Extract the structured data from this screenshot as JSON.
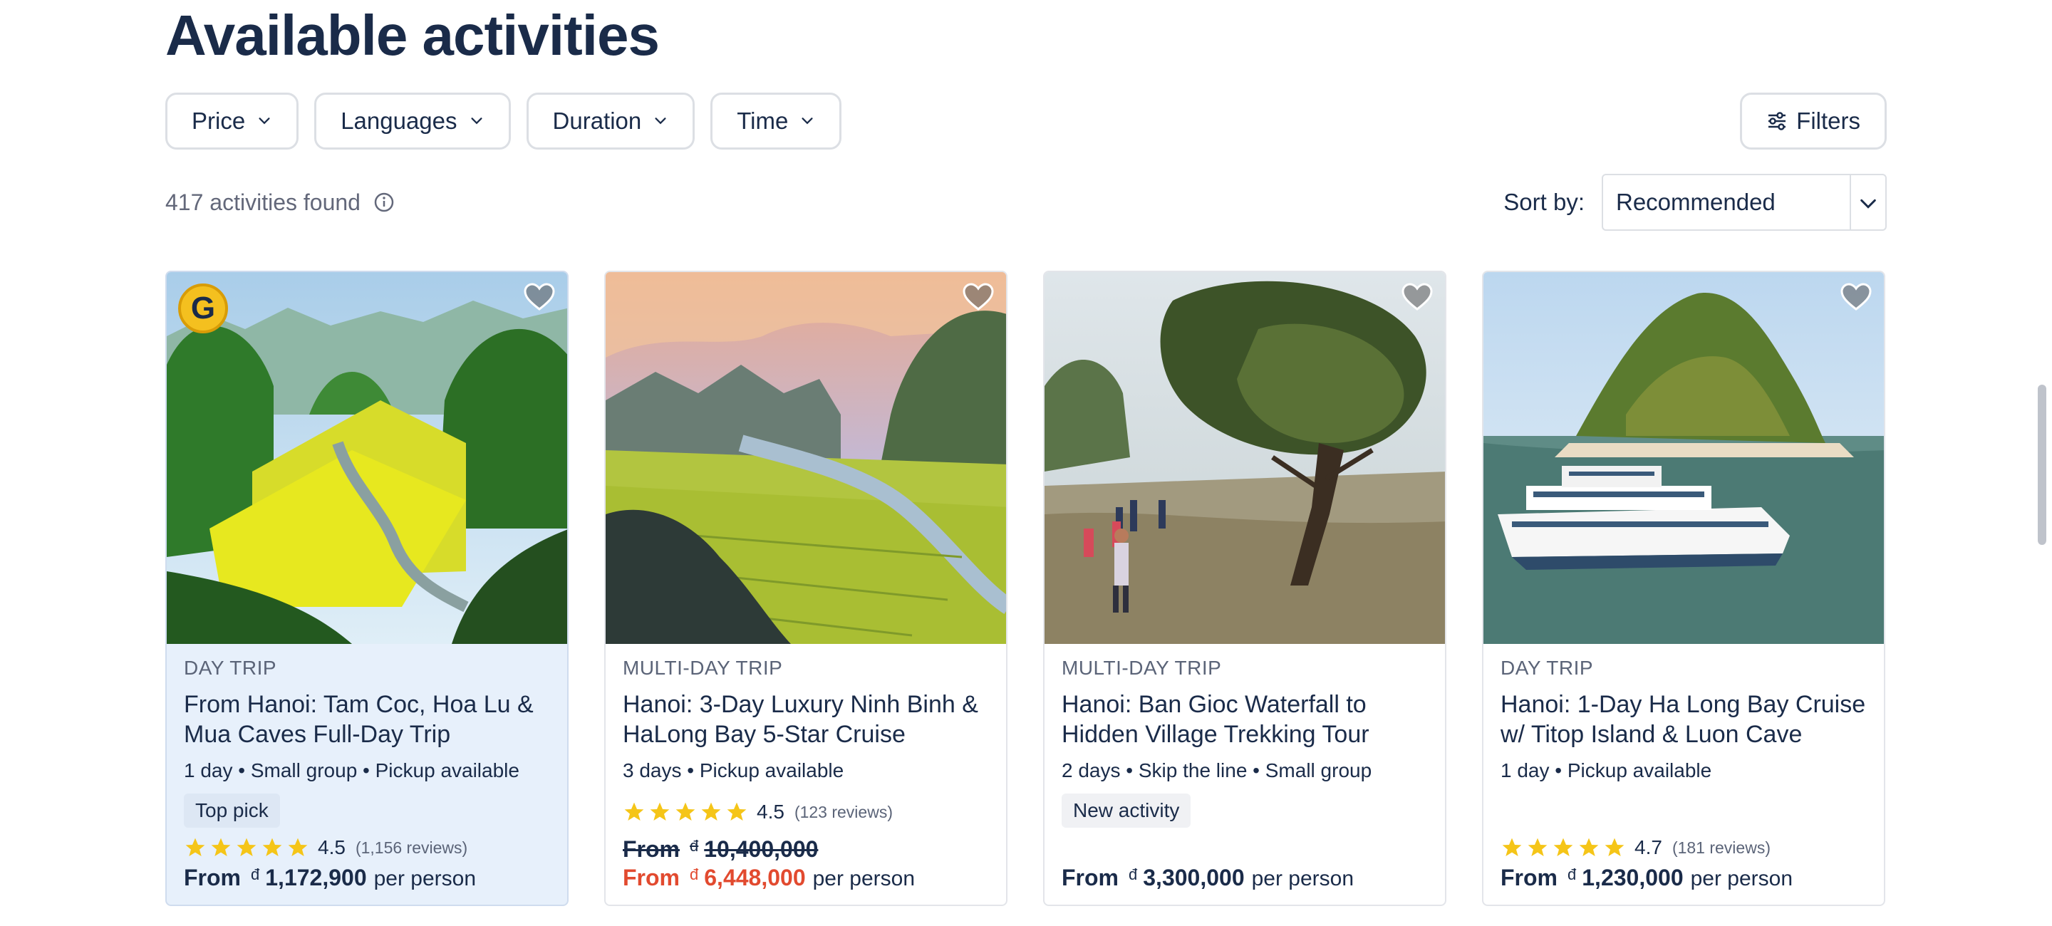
{
  "heading": "Available activities",
  "filters": [
    "Price",
    "Languages",
    "Duration",
    "Time"
  ],
  "filters_button": "Filters",
  "results_count": "417 activities found",
  "sort": {
    "label": "Sort by:",
    "value": "Recommended"
  },
  "colors": {
    "text": "#1a2b49",
    "sale": "#e24a2f",
    "star": "#f5c518",
    "highlight_bg": "#e7f0fb"
  },
  "cards": [
    {
      "category": "DAY TRIP",
      "title": "From Hanoi: Tam Coc, Hoa Lu & Mua Caves Full-Day Trip",
      "meta": "1 day • Small group • Pickup available",
      "tag": "Top pick",
      "rating": "4.5",
      "reviews": "(1,156 reviews)",
      "price_from": "From",
      "currency": "đ",
      "price": "1,172,900",
      "per": "per person",
      "badge": "G"
    },
    {
      "category": "MULTI-DAY TRIP",
      "title": "Hanoi: 3-Day Luxury Ninh Binh & HaLong Bay 5-Star Cruise",
      "meta": "3 days • Pickup available",
      "rating": "4.5",
      "reviews": "(123 reviews)",
      "price_from": "From",
      "currency": "đ",
      "old_price": "10,400,000",
      "price": "6,448,000",
      "per": "per person"
    },
    {
      "category": "MULTI-DAY TRIP",
      "title": "Hanoi: Ban Gioc Waterfall to Hidden Village Trekking Tour",
      "meta": "2 days • Skip the line • Small group",
      "tag": "New activity",
      "price_from": "From",
      "currency": "đ",
      "price": "3,300,000",
      "per": "per person"
    },
    {
      "category": "DAY TRIP",
      "title": "Hanoi: 1-Day Ha Long Bay Cruise w/ Titop Island & Luon Cave",
      "meta": "1 day • Pickup available",
      "rating": "4.7",
      "reviews": "(181 reviews)",
      "price_from": "From",
      "currency": "đ",
      "price": "1,230,000",
      "per": "per person"
    }
  ]
}
